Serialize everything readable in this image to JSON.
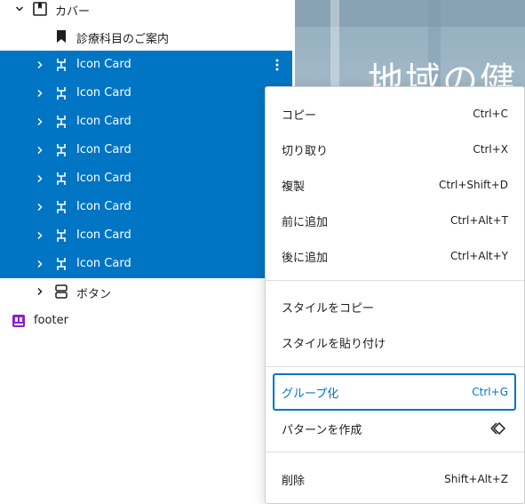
{
  "list": {
    "cover_label": "カバー",
    "shortcode_label": "診療科目のご案内",
    "icon_cards": [
      "Icon Card",
      "Icon Card",
      "Icon Card",
      "Icon Card",
      "Icon Card",
      "Icon Card",
      "Icon Card",
      "Icon Card"
    ],
    "button_label": "ボタン",
    "footer_label": "footer"
  },
  "preview": {
    "hero_text": "地域の健"
  },
  "menu": {
    "copy": {
      "label": "コピー",
      "shortcut": "Ctrl+C"
    },
    "cut": {
      "label": "切り取り",
      "shortcut": "Ctrl+X"
    },
    "duplicate": {
      "label": "複製",
      "shortcut": "Ctrl+Shift+D"
    },
    "insert_before": {
      "label": "前に追加",
      "shortcut": "Ctrl+Alt+T"
    },
    "insert_after": {
      "label": "後に追加",
      "shortcut": "Ctrl+Alt+Y"
    },
    "copy_styles": {
      "label": "スタイルをコピー"
    },
    "paste_styles": {
      "label": "スタイルを貼り付け"
    },
    "group": {
      "label": "グループ化",
      "shortcut": "Ctrl+G"
    },
    "create_pattern": {
      "label": "パターンを作成"
    },
    "delete": {
      "label": "削除",
      "shortcut": "Shift+Alt+Z"
    }
  },
  "colors": {
    "selection": "#0075c4",
    "footer_icon": "#8a1fd1",
    "text": "#1e1e1e"
  }
}
